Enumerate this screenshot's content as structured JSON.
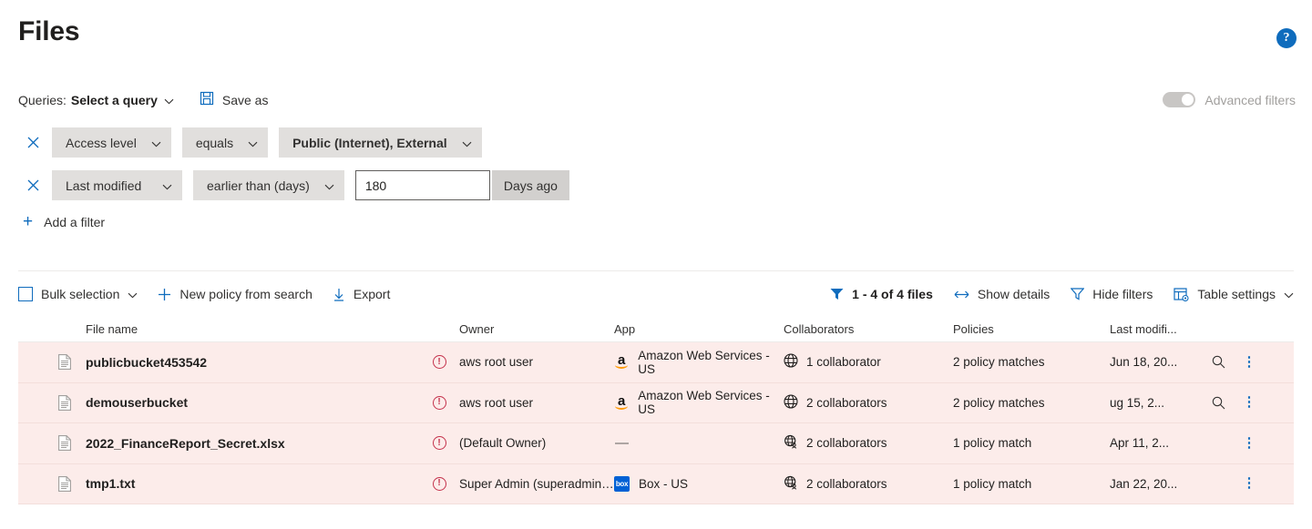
{
  "header": {
    "title": "Files",
    "help_icon": "question-mark-icon",
    "help_label": "?"
  },
  "queries": {
    "label": "Queries:",
    "selected": "Select a query",
    "chevron": "⌄",
    "save_as": "Save as",
    "save_icon": "save-disk-icon"
  },
  "advanced_filters": {
    "label": "Advanced filters",
    "enabled": false
  },
  "filters": {
    "rows": [
      {
        "remove_icon": "close-icon",
        "field": "Access level",
        "operator": "equals",
        "value": "Public (Internet), External",
        "value_bold": true
      },
      {
        "remove_icon": "close-icon",
        "field": "Last modified",
        "operator": "earlier than (days)",
        "input_value": "180",
        "input_placeholder": "",
        "suffix_button": "Days ago"
      }
    ],
    "add_filter": "Add a filter",
    "add_icon": "plus-icon"
  },
  "toolbar": {
    "left": [
      {
        "label": "Bulk selection",
        "icon": "checkbox-icon",
        "chevron": "⌄"
      },
      {
        "label": "New policy from search",
        "icon": "plus-icon"
      },
      {
        "label": "Export",
        "icon": "download-icon"
      }
    ],
    "right": {
      "filter_icon": "funnel-filled-icon",
      "count": "1 - 4 of 4 files",
      "show_details": "Show details",
      "show_details_icon": "expand-horizontal-icon",
      "hide_filters": "Hide filters",
      "hide_filters_icon": "funnel-outline-icon",
      "table_settings": "Table settings",
      "table_settings_icon": "table-gear-icon",
      "table_settings_chevron": "⌄"
    }
  },
  "table": {
    "columns": [
      "File name",
      "Owner",
      "App",
      "Collaborators",
      "Policies",
      "Last modifi..."
    ],
    "rows": [
      {
        "file_icon": "document-icon",
        "name": "publicbucket453542",
        "alert_icon": "alert-circle-icon",
        "owner": "aws root user",
        "app": "Amazon Web Services - US",
        "app_icon": "amazon-icon",
        "collaborators": "1 collaborator",
        "collab_icon": "globe-icon",
        "policies": "2 policy matches",
        "last_modified": "Jun 18, 20...",
        "has_search": true,
        "search_icon": "magnifier-icon",
        "more_icon": "more-vertical-icon"
      },
      {
        "file_icon": "document-icon",
        "name": "demouserbucket",
        "alert_icon": "alert-circle-icon",
        "owner": "aws root user",
        "app": "Amazon Web Services - US",
        "app_icon": "amazon-icon",
        "collaborators": "2 collaborators",
        "collab_icon": "globe-icon",
        "policies": "2 policy matches",
        "last_modified": "ug 15, 2...",
        "has_search": true,
        "search_icon": "magnifier-icon",
        "more_icon": "more-vertical-icon"
      },
      {
        "file_icon": "document-icon",
        "name": "2022_FinanceReport_Secret.xlsx",
        "alert_icon": "alert-circle-icon",
        "owner": "(Default Owner)",
        "app": "—",
        "app_icon": "dash-icon",
        "collaborators": "2 collaborators",
        "collab_icon": "globe-person-icon",
        "policies": "1 policy match",
        "last_modified": "Apr 11, 2...",
        "has_search": false,
        "search_icon": "",
        "more_icon": "more-vertical-icon"
      },
      {
        "file_icon": "document-icon",
        "name": "tmp1.txt",
        "alert_icon": "alert-circle-icon",
        "owner": "Super Admin (superadmin@c...",
        "app": "Box - US",
        "app_icon": "box-icon",
        "collaborators": "2 collaborators",
        "collab_icon": "globe-person-icon",
        "policies": "1 policy match",
        "last_modified": "Jan 22, 20...",
        "has_search": false,
        "search_icon": "",
        "more_icon": "more-vertical-icon"
      }
    ]
  },
  "colors": {
    "accent": "#0f6cbd",
    "row_alert_bg": "#fcecea",
    "alert_red": "#c4314b",
    "pill_bg": "#e1dfdd"
  }
}
